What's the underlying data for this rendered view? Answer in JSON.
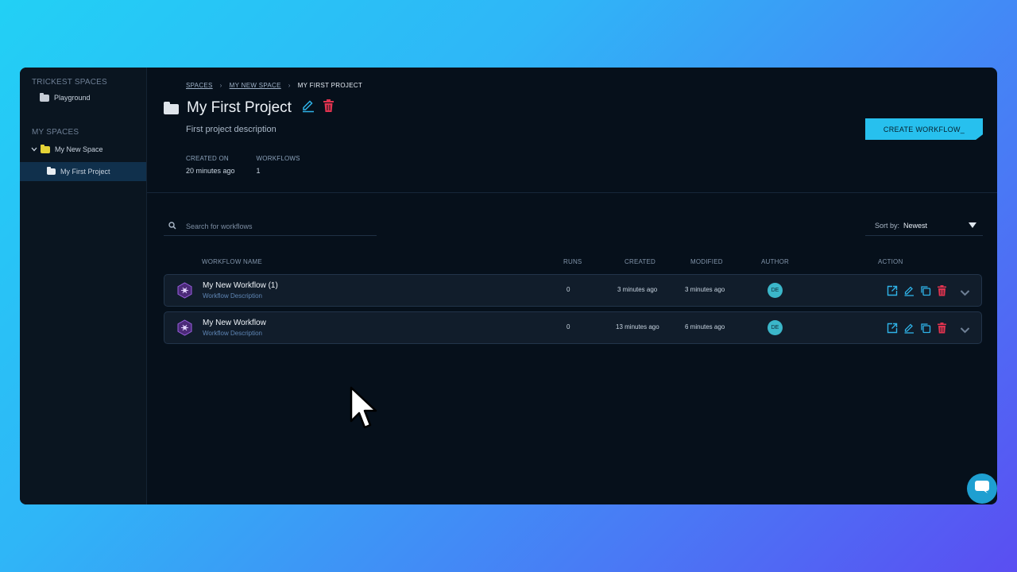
{
  "sidebar": {
    "trickest_title": "TRICKEST SPACES",
    "trickest_items": [
      {
        "label": "Playground"
      }
    ],
    "my_spaces_title": "MY SPACES",
    "space": {
      "label": "My New Space"
    },
    "project": {
      "label": "My First Project"
    }
  },
  "breadcrumb": {
    "spaces": "SPACES",
    "space": "MY NEW SPACE",
    "current": "MY FIRST PROJECT"
  },
  "project": {
    "title": "My First Project",
    "description": "First project description",
    "created_label": "CREATED ON",
    "created_value": "20 minutes ago",
    "workflows_label": "WORKFLOWS",
    "workflows_value": "1"
  },
  "create_button": "CREATE WORKFLOW_",
  "search": {
    "placeholder": "Search for workflows"
  },
  "sort": {
    "label": "Sort by:",
    "value": "Newest"
  },
  "table": {
    "headers": {
      "name": "WORKFLOW NAME",
      "runs": "RUNS",
      "created": "CREATED",
      "modified": "MODIFIED",
      "author": "AUTHOR",
      "action": "ACTION"
    },
    "rows": [
      {
        "name": "My New Workflow (1)",
        "description": "Workflow Description",
        "runs": "0",
        "created": "3 minutes ago",
        "modified": "3 minutes ago",
        "author": "DE"
      },
      {
        "name": "My New Workflow",
        "description": "Workflow Description",
        "runs": "0",
        "created": "13 minutes ago",
        "modified": "6 minutes ago",
        "author": "DE"
      }
    ]
  },
  "colors": {
    "accent": "#27c0ee",
    "danger": "#e0334f",
    "workflow_icon": "#7b3fb8"
  }
}
